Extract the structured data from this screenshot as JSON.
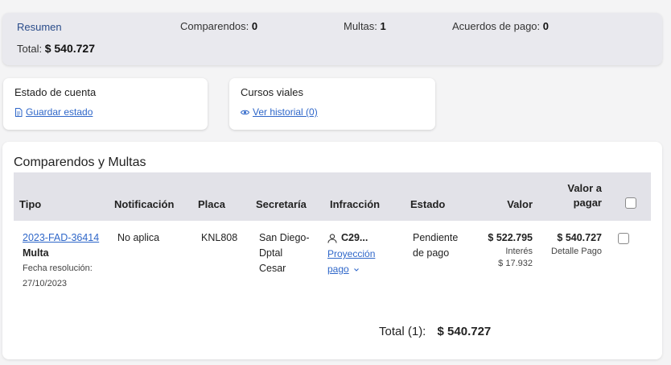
{
  "summary": {
    "title": "Resumen",
    "comparendos_label": "Comparendos:",
    "comparendos_value": "0",
    "multas_label": "Multas:",
    "multas_value": "1",
    "acuerdos_label": "Acuerdos de pago:",
    "acuerdos_value": "0",
    "total_label": "Total:",
    "total_value": "$ 540.727"
  },
  "cards": {
    "estado": {
      "title": "Estado de cuenta",
      "link": "Guardar estado",
      "icon": "document-icon"
    },
    "cursos": {
      "title": "Cursos viales",
      "link": "Ver historial (0)",
      "icon": "eye-icon"
    }
  },
  "table": {
    "heading": "Comparendos y Multas",
    "headers": {
      "tipo": "Tipo",
      "notificacion": "Notificación",
      "placa": "Placa",
      "secretaria": "Secretaría",
      "infraccion": "Infracción",
      "estado": "Estado",
      "valor": "Valor",
      "valor_pagar_1": "Valor a",
      "valor_pagar_2": "pagar"
    },
    "row": {
      "id": "2023-FAD-36414",
      "tipo": "Multa",
      "fecha_label": "Fecha resolución:",
      "fecha": "27/10/2023",
      "notificacion": "No aplica",
      "placa": "KNL808",
      "secretaria_1": "San Diego-",
      "secretaria_2": "Dptal",
      "secretaria_3": "Cesar",
      "infraccion": "C29...",
      "proyeccion_1": "Proyección",
      "proyeccion_2": "pago",
      "estado_1": "Pendiente",
      "estado_2": "de pago",
      "valor": "$ 522.795",
      "interes_label": "Interés",
      "interes": "$ 17.932",
      "valor_pagar": "$ 540.727",
      "detalle": "Detalle Pago"
    },
    "total_label": "Total (1):",
    "total_value": "$ 540.727"
  }
}
